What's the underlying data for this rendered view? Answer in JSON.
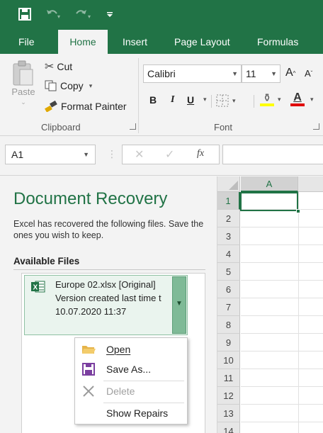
{
  "ribbon_tabs": [
    {
      "label": "File"
    },
    {
      "label": "Home"
    },
    {
      "label": "Insert"
    },
    {
      "label": "Page Layout"
    },
    {
      "label": "Formulas"
    }
  ],
  "clipboard": {
    "paste": "Paste",
    "cut": "Cut",
    "copy": "Copy",
    "format_painter": "Format Painter",
    "group_label": "Clipboard"
  },
  "font": {
    "name": "Calibri",
    "size": "11",
    "bold": "B",
    "italic": "I",
    "underline": "U",
    "group_label": "Font"
  },
  "formula_bar": {
    "name_box": "A1",
    "fx": "fx"
  },
  "recovery": {
    "title": "Document Recovery",
    "description": "Excel has recovered the following files. Save the ones you wish to keep.",
    "available_files": "Available Files",
    "file": {
      "name": "Europe 02.xlsx  [Original]",
      "version": "Version created last time t",
      "date": "10.07.2020 11:37"
    }
  },
  "context_menu": {
    "open": "Open",
    "save_as": "Save As...",
    "delete": "Delete",
    "show_repairs": "Show Repairs"
  },
  "grid": {
    "column": "A",
    "rows": [
      "1",
      "2",
      "3",
      "4",
      "5",
      "6",
      "7",
      "8",
      "9",
      "10",
      "11",
      "12",
      "13",
      "14"
    ]
  },
  "colors": {
    "accent": "#217346",
    "file_highlight": "#eaf4ee"
  }
}
